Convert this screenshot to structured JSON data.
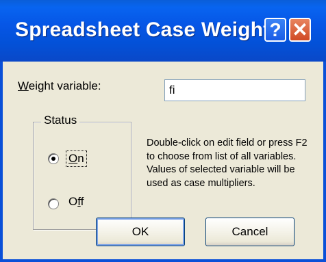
{
  "window": {
    "title": "Spreadsheet Case Weights",
    "help_glyph": "?",
    "close_glyph": "✕",
    "colors": {
      "titlebar": "#0656e6",
      "frame": "#0a50d8",
      "client": "#ece9d8",
      "close_button": "#d04a25"
    }
  },
  "weight": {
    "label_underlined": "W",
    "label_rest": "eight variable:",
    "value": "fi"
  },
  "status": {
    "legend": "Status",
    "on_underlined": "O",
    "on_rest": "n",
    "off_first": "O",
    "off_underlined": "f",
    "off_last": "f",
    "selected": "on"
  },
  "help_text": "Double-click on edit field or press F2 to choose from list of all variables. Values of selected variable will be used as case multipliers.",
  "buttons": {
    "ok": "OK",
    "cancel": "Cancel"
  }
}
